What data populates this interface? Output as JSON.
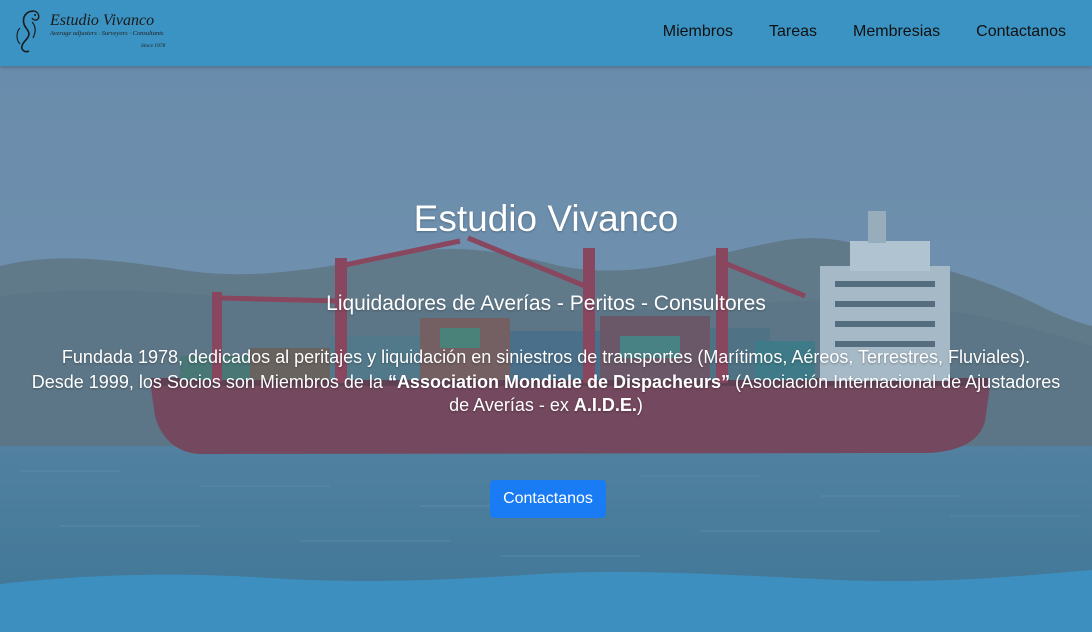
{
  "brand": {
    "name": "Estudio Vivanco",
    "tagline": "Average adjusters · Surveyors · Consultants",
    "since": "Since 1978"
  },
  "nav": {
    "items": [
      {
        "label": "Miembros"
      },
      {
        "label": "Tareas"
      },
      {
        "label": "Membresias"
      },
      {
        "label": "Contactanos"
      }
    ]
  },
  "hero": {
    "title": "Estudio Vivanco",
    "subtitle": "Liquidadores de Averías - Peritos - Consultores",
    "paragraph1": "Fundada 1978, dedicados al peritajes y liquidación en siniestros de transportes (Marítimos, Aéreos, Terrestres, Fluviales).",
    "p2_part1": "Desde 1999, los Socios son Miembros de la ",
    "p2_bold1": "“Association Mondiale de Dispacheurs”",
    "p2_part2": " (Asociación Internacional de Ajustadores de Averías - ex ",
    "p2_bold2": "A.I.D.E.",
    "p2_part3": ")",
    "cta_label": "Contactanos"
  },
  "colors": {
    "navbar": "#3a93c2",
    "wave": "#3d8fbf",
    "button": "#1a7cf5",
    "text": "#ffffff"
  },
  "icons": {
    "logo": "seahorse-logo-icon"
  }
}
